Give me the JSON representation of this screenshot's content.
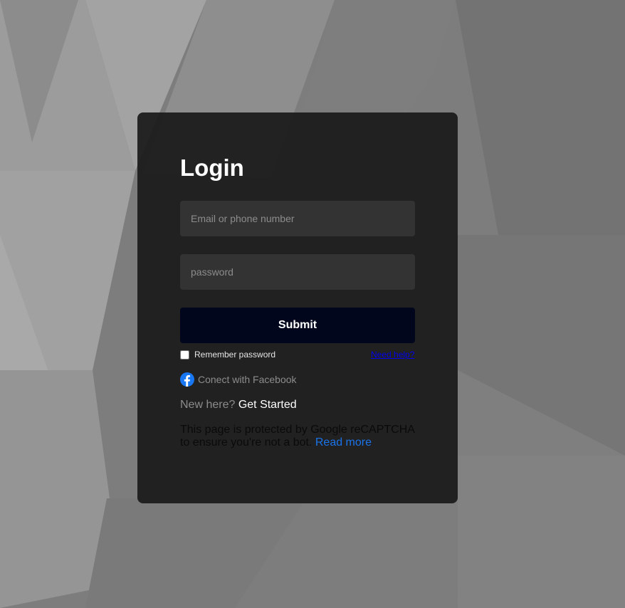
{
  "login": {
    "title": "Login",
    "email_placeholder": "Email or phone number",
    "password_placeholder": "password",
    "submit_label": "Submit",
    "remember_label": "Remember password",
    "help_link": "Need help?",
    "facebook_label": "Conect with Facebook",
    "new_here": "New here?",
    "get_started": "Get Started",
    "captcha_text": "This page is protected by Google reCAPTCHA to ensure you're not a bot.",
    "read_more": "Read more"
  },
  "icons": {
    "facebook": "facebook-icon"
  },
  "colors": {
    "card_background": "#1f1f1f",
    "submit_background": "#01061c",
    "facebook_blue": "#1877f2",
    "link_blue": "#1a73e8"
  }
}
